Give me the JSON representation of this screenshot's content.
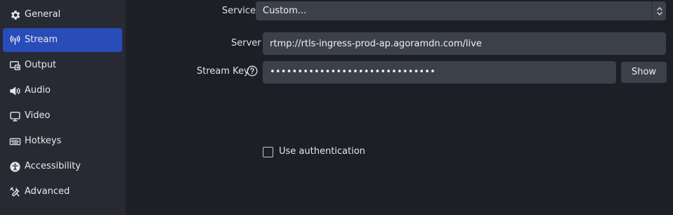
{
  "sidebar": {
    "items": [
      {
        "label": "General",
        "icon": "gear-icon"
      },
      {
        "label": "Stream",
        "icon": "antenna-icon",
        "active": true
      },
      {
        "label": "Output",
        "icon": "output-icon"
      },
      {
        "label": "Audio",
        "icon": "speaker-icon"
      },
      {
        "label": "Video",
        "icon": "monitor-icon"
      },
      {
        "label": "Hotkeys",
        "icon": "keyboard-icon"
      },
      {
        "label": "Accessibility",
        "icon": "accessibility-icon"
      },
      {
        "label": "Advanced",
        "icon": "wrench-icon"
      }
    ]
  },
  "stream": {
    "service_label": "Service",
    "service_value": "Custom...",
    "server_label": "Server",
    "server_value": "rtmp://rtls-ingress-prod-ap.agoramdn.com/live",
    "key_label": "Stream Key",
    "key_masked": "••••••••••••••••••••••••••••••",
    "show_label": "Show",
    "use_auth_label": "Use authentication",
    "use_auth_checked": false
  },
  "colors": {
    "sidebar_bg": "#272a33",
    "main_bg": "#1d1f26",
    "accent": "#284cb8",
    "field_bg": "#3c404b"
  }
}
